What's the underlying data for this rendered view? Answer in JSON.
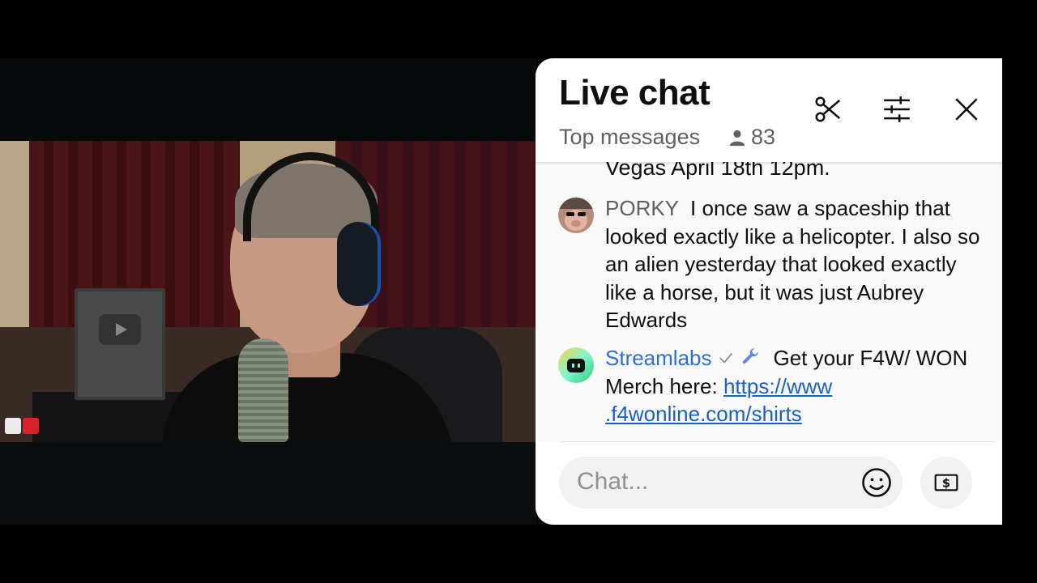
{
  "chat": {
    "title": "Live chat",
    "mode": "Top messages",
    "viewer_count": "83",
    "partial_line": "Vegas April 18th 12pm.",
    "messages": [
      {
        "author": "PORKY",
        "text": "I once saw a spaceship that looked exactly like a helicopter. I also so an alien yesterday that looked exactly like a horse, but it was just Aubrey Edwards"
      },
      {
        "author": "Streamlabs",
        "text": "Get your F4W/ WON Merch here: ",
        "link": "https://www .f4wonline.com/shirts"
      }
    ],
    "input_placeholder": "Chat..."
  },
  "icons": {
    "clip": "scissors-icon",
    "filter": "tune-icon",
    "close": "close-icon",
    "viewers": "person-icon",
    "verified": "check-icon",
    "moderator": "wrench-icon",
    "emoji": "smiley-icon",
    "super_chat": "dollar-icon"
  },
  "colors": {
    "owner_name": "#2b6fd6",
    "link": "#1a5fc7",
    "panel_bg": "#f9f9f9"
  }
}
